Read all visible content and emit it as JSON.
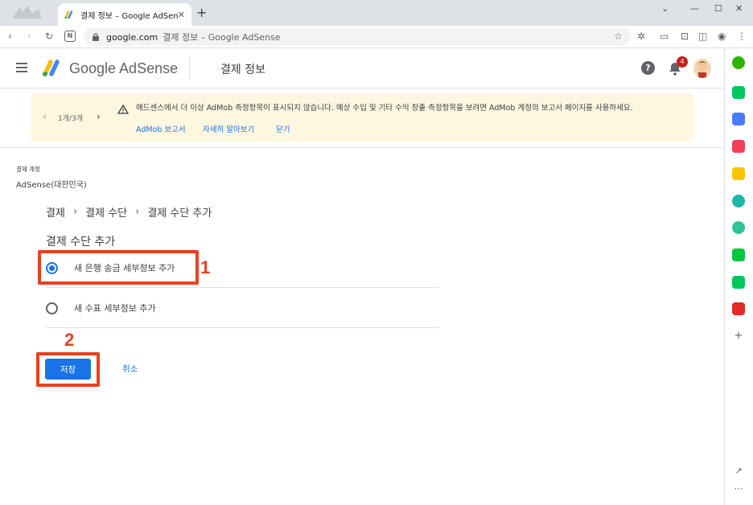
{
  "browser": {
    "tab_title": "결제 정보 – Google AdSense",
    "tab_close": "✕",
    "new_tab": "+",
    "url_host": "google.com",
    "url_rest": "결제 정보 – Google AdSense"
  },
  "header": {
    "brand": "Google AdSense",
    "page_title": "결제 정보",
    "help": "?",
    "notification_count": "4"
  },
  "banner": {
    "pager": "1개/3개",
    "message": "애드센스에서 더 이상 AdMob 측정항목이 표시되지 않습니다. 예상 수입 및 기타 수익 창출 측정항목을 보려면 AdMob 계정의 보고서 페이지를 사용하세요.",
    "link_admob": "AdMob 보고서",
    "link_learn": "자세히 알아보기",
    "link_close": "닫기"
  },
  "account": {
    "label": "결제 계정",
    "name": "AdSense(대한민국)"
  },
  "breadcrumb": [
    "결제",
    "결제 수단",
    "결제 수단 추가"
  ],
  "section_title": "결제 수단 추가",
  "options": [
    {
      "label": "새 은행 송금 세부정보 추가",
      "selected": true
    },
    {
      "label": "새 수표 세부정보 추가",
      "selected": false
    }
  ],
  "actions": {
    "save": "저장",
    "cancel": "취소"
  },
  "annotations": {
    "one": "1",
    "two": "2",
    "color": "#e8401e"
  },
  "colors": {
    "accent": "#1a73e8",
    "banner_bg": "#fef7e0"
  }
}
